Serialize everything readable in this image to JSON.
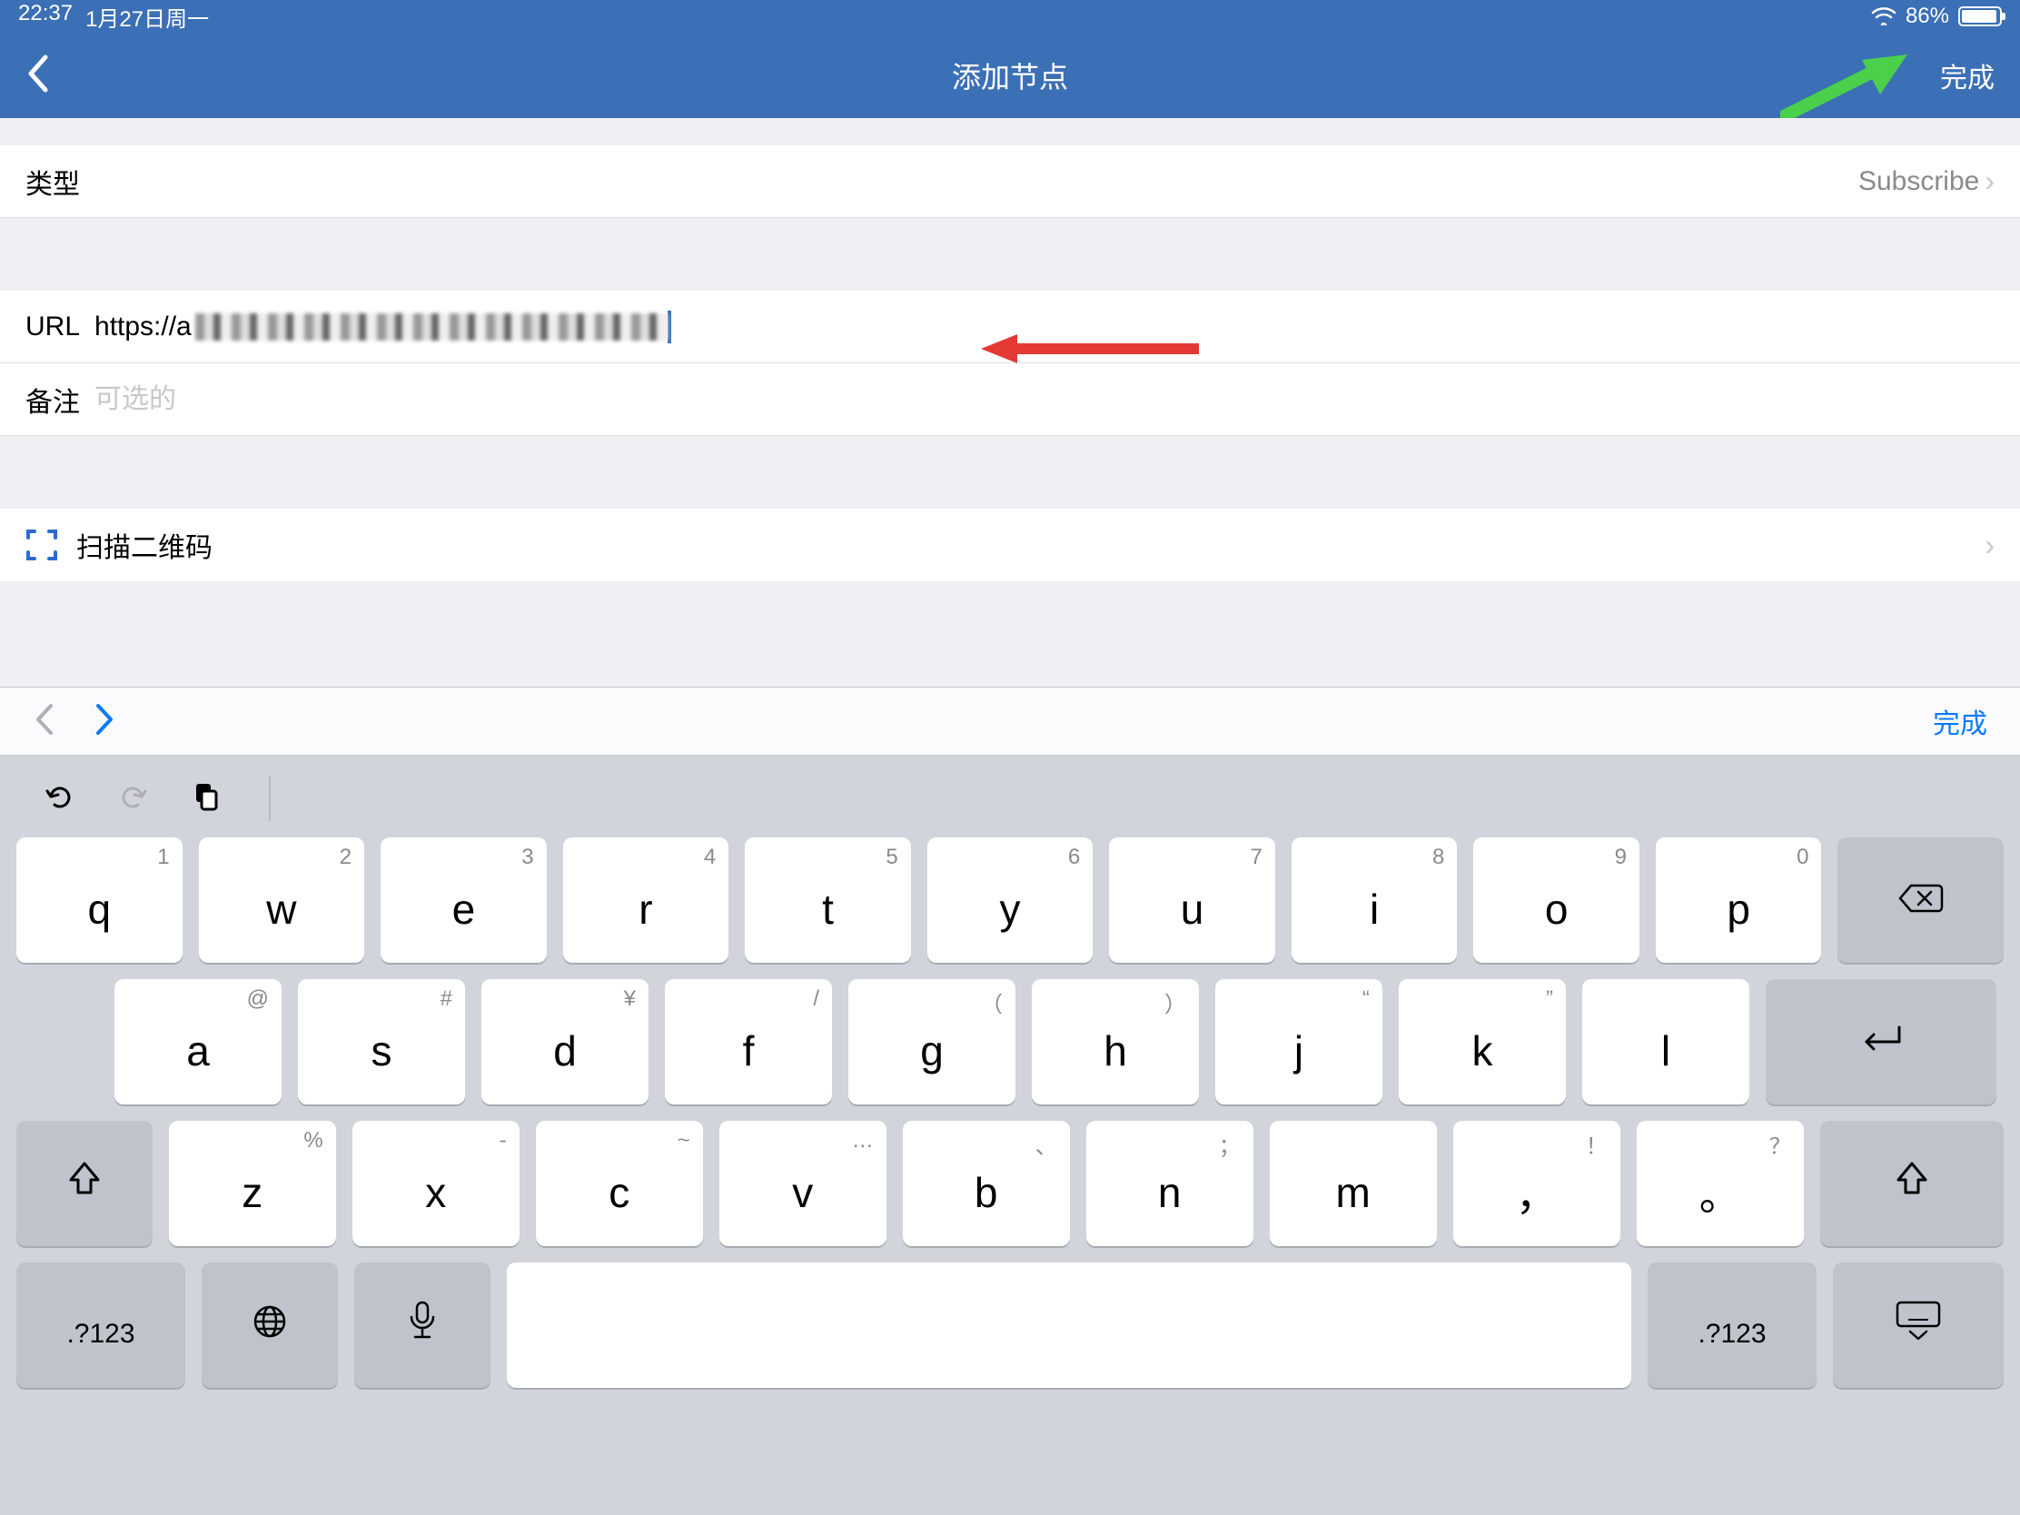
{
  "statusbar": {
    "time": "22:37",
    "date": "1月27日周一",
    "battery_pct": "86%"
  },
  "navbar": {
    "title": "添加节点",
    "done": "完成"
  },
  "form": {
    "type": {
      "label": "类型",
      "value": "Subscribe"
    },
    "url": {
      "label": "URL",
      "value": "https://a"
    },
    "note": {
      "label": "备注",
      "placeholder": "可选的"
    },
    "scan": {
      "label": "扫描二维码"
    }
  },
  "kb_accessory": {
    "done": "完成"
  },
  "keyboard": {
    "row1": [
      {
        "alt": "1",
        "key": "q"
      },
      {
        "alt": "2",
        "key": "w"
      },
      {
        "alt": "3",
        "key": "e"
      },
      {
        "alt": "4",
        "key": "r"
      },
      {
        "alt": "5",
        "key": "t"
      },
      {
        "alt": "6",
        "key": "y"
      },
      {
        "alt": "7",
        "key": "u"
      },
      {
        "alt": "8",
        "key": "i"
      },
      {
        "alt": "9",
        "key": "o"
      },
      {
        "alt": "0",
        "key": "p"
      }
    ],
    "row2": [
      {
        "alt": "@",
        "key": "a"
      },
      {
        "alt": "#",
        "key": "s"
      },
      {
        "alt": "¥",
        "key": "d"
      },
      {
        "alt": "/",
        "key": "f"
      },
      {
        "alt": "（",
        "key": "g"
      },
      {
        "alt": "）",
        "key": "h"
      },
      {
        "alt": "“",
        "key": "j"
      },
      {
        "alt": "”",
        "key": "k"
      },
      {
        "alt": "",
        "key": "l"
      }
    ],
    "row3": [
      {
        "alt": "%",
        "key": "z"
      },
      {
        "alt": "-",
        "key": "x"
      },
      {
        "alt": "~",
        "key": "c"
      },
      {
        "alt": "…",
        "key": "v"
      },
      {
        "alt": "、",
        "key": "b"
      },
      {
        "alt": "；",
        "key": "n"
      },
      {
        "alt": "",
        "key": "m"
      },
      {
        "alt": "！",
        "key": "，"
      },
      {
        "alt": "？",
        "key": "。"
      }
    ],
    "numkey": ".?123"
  }
}
